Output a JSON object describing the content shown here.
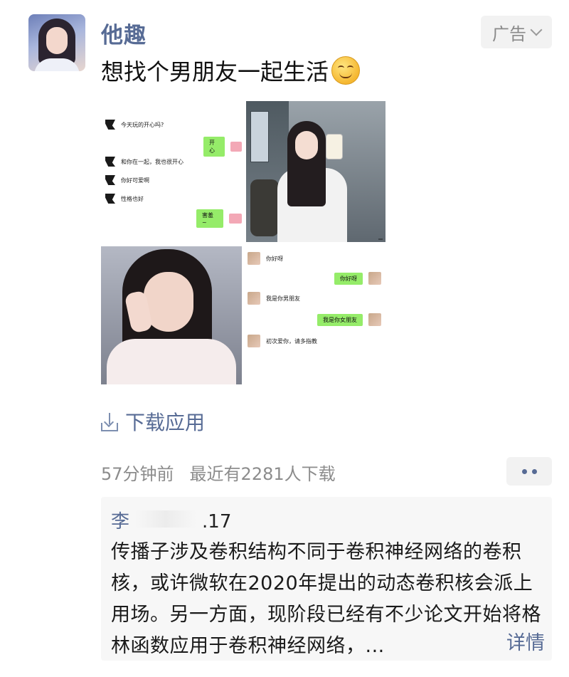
{
  "post": {
    "author": "他趣",
    "ad_label": "广告",
    "text": "想找个男朋友一起生活",
    "emoji": "shy-face-emoji"
  },
  "images": {
    "tile1_chat": [
      {
        "side": "left",
        "text": "今天玩的开心吗?"
      },
      {
        "side": "right",
        "text": "开心"
      },
      {
        "side": "left",
        "text": "和你在一起，我也很开心"
      },
      {
        "side": "left",
        "text": "你好可爱啊"
      },
      {
        "side": "left",
        "text": "性格也好"
      },
      {
        "side": "right",
        "text": "害羞~"
      }
    ],
    "tile4_chat": [
      {
        "side": "left",
        "text": "你好呀"
      },
      {
        "side": "right",
        "text": "你好呀"
      },
      {
        "side": "left",
        "text": "我是你男朋友"
      },
      {
        "side": "right",
        "text": "我是你女朋友"
      },
      {
        "side": "left",
        "text": "初次爱你，请多指教"
      }
    ]
  },
  "download_label": "下载应用",
  "meta": {
    "time": "57分钟前",
    "downloads": "最近有2281人下载"
  },
  "comment": {
    "name": "李",
    "suffix": ".17",
    "text": "传播子涉及卷积结构不同于卷积神经网络的卷积核，或许微软在2020年提出的动态卷积核会派上用场。另一方面，现阶段已经有不少论文开始将格林函数应用于卷积神经网络，...",
    "details_label": "详情"
  },
  "colors": {
    "link_blue": "#576b95",
    "gray_text": "#8c8c8c",
    "chat_green": "#95ec69"
  }
}
